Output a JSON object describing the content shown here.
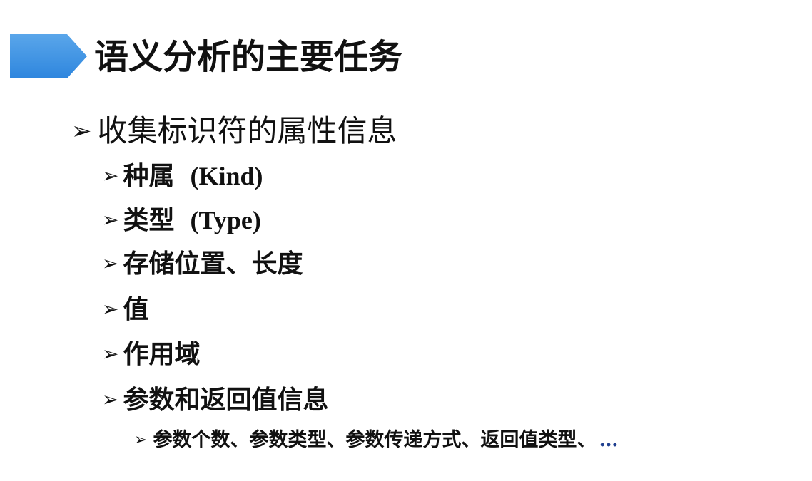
{
  "colors": {
    "title_bar": "#2e86de",
    "title_bar_light": "#5aa6ea",
    "ellipsis": "#1f3f8f"
  },
  "title": "语义分析的主要任务",
  "level1": {
    "bullet_icon": "arrow-bullet-icon",
    "text": "收集标识符的属性信息"
  },
  "level2": [
    {
      "cn": "种属",
      "en": "(Kind)"
    },
    {
      "cn": "类型",
      "en": "(Type)"
    },
    {
      "cn": "存储位置、长度",
      "en": ""
    },
    {
      "cn": "值",
      "en": ""
    },
    {
      "cn": "作用域",
      "en": ""
    },
    {
      "cn": "参数和返回值信息",
      "en": ""
    }
  ],
  "level3": {
    "text": "参数个数、参数类型、参数传递方式、返回值类型、",
    "ellipsis": "…"
  }
}
